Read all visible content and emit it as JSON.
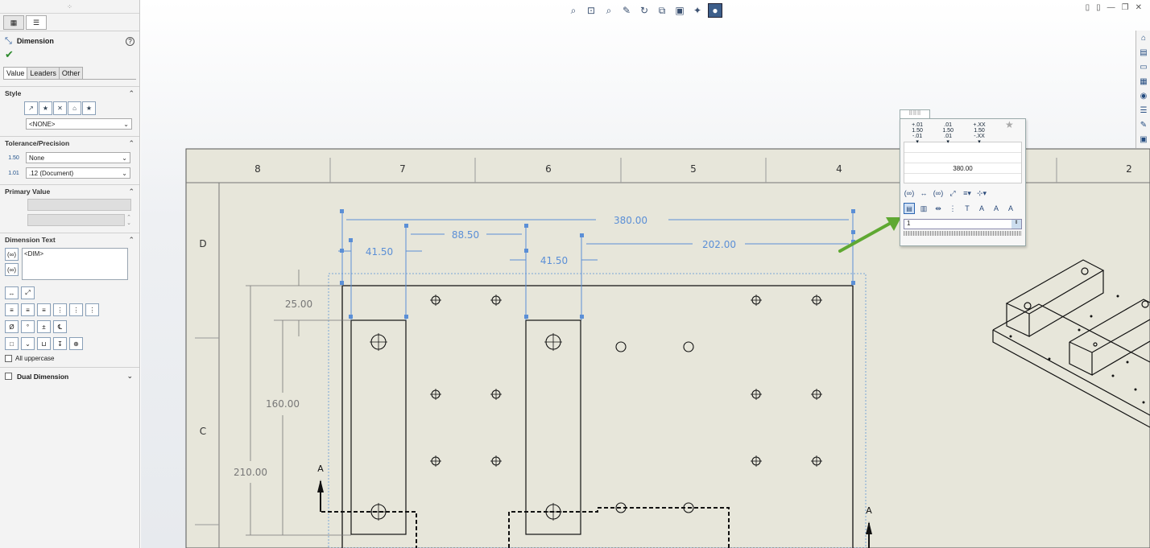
{
  "property_manager": {
    "title": "Dimension",
    "help": "?",
    "ok_glyph": "✔",
    "tabs": [
      "Value",
      "Leaders",
      "Other"
    ],
    "style": {
      "heading": "Style",
      "selected": "<NONE>",
      "icons": [
        "apply-style-icon",
        "add-style-icon",
        "delete-style-icon",
        "save-style-icon",
        "load-style-icon"
      ]
    },
    "tolerance": {
      "heading": "Tolerance/Precision",
      "type": "None",
      "precision": ".12 (Document)"
    },
    "primary_value": {
      "heading": "Primary Value"
    },
    "dimension_text": {
      "heading": "Dimension Text",
      "value": "<DIM>",
      "all_uppercase": "All uppercase"
    },
    "dual_dimension": "Dual Dimension"
  },
  "palette": {
    "value": "380.00",
    "input": "1",
    "tolerance_samples": [
      {
        "top": "+.01",
        "main": "1.50",
        "bottom": "-.01"
      },
      {
        "top": ".01",
        "main": "1.50",
        "bottom": ".01"
      },
      {
        "top": "+.XX",
        "main": "1.50",
        "bottom": "-.XX"
      }
    ]
  },
  "drawing": {
    "zones_columns": [
      "8",
      "7",
      "6",
      "5",
      "4",
      "2"
    ],
    "zones_rows": [
      "D",
      "C"
    ],
    "section_label": "A",
    "dimensions": [
      "380.00",
      "88.50",
      "41.50",
      "41.50",
      "202.00",
      "25.00",
      "160.00",
      "210.00"
    ]
  },
  "colors": {
    "sheet": "#e7e6da",
    "dim": "#5b8fd6",
    "accent_arrow": "#5fa832"
  }
}
